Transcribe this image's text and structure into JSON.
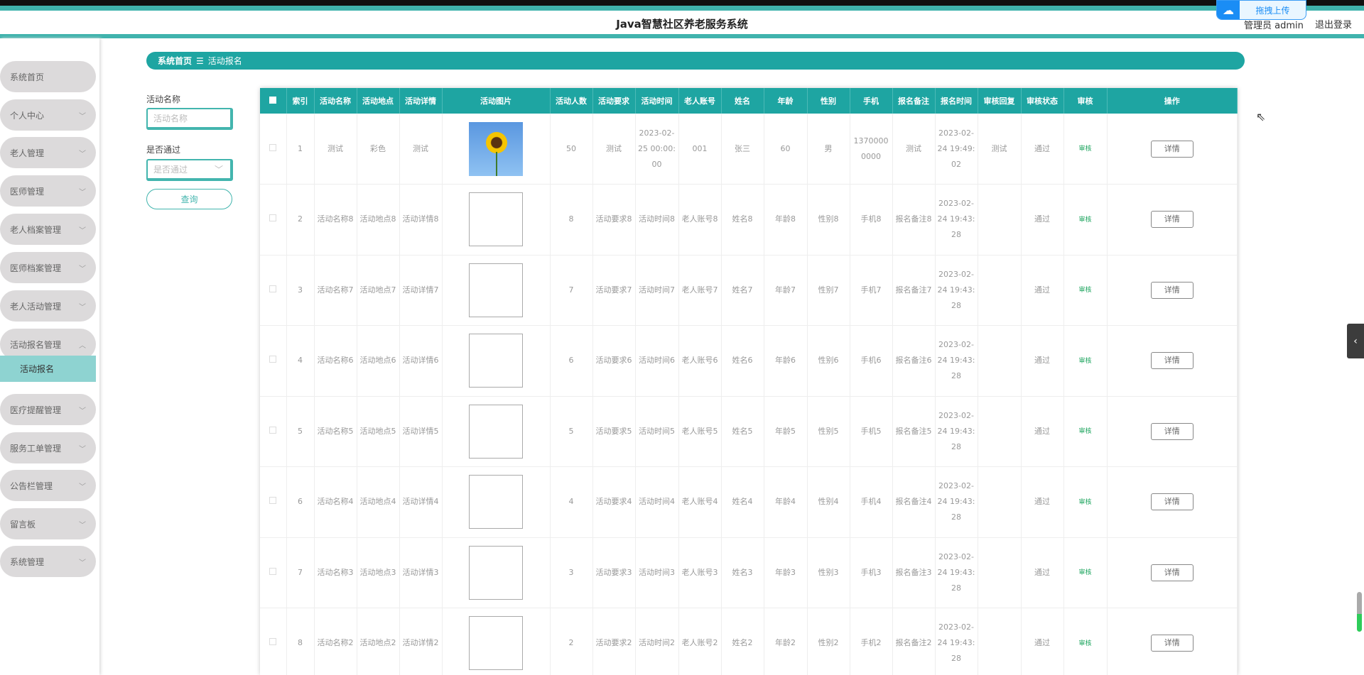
{
  "header": {
    "title": "Java智慧社区养老服务系统",
    "user": "管理员 admin",
    "logout": "退出登录",
    "upload": "拖拽上传"
  },
  "sidebar": {
    "items": [
      {
        "label": "系统首页",
        "chev": ""
      },
      {
        "label": "个人中心",
        "chev": "﹀"
      },
      {
        "label": "老人管理",
        "chev": "﹀"
      },
      {
        "label": "医师管理",
        "chev": "﹀"
      },
      {
        "label": "老人档案管理",
        "chev": "﹀"
      },
      {
        "label": "医师档案管理",
        "chev": "﹀"
      },
      {
        "label": "老人活动管理",
        "chev": "﹀"
      },
      {
        "label": "活动报名管理",
        "chev": "︿"
      },
      {
        "label": "医疗提醒管理",
        "chev": "﹀"
      },
      {
        "label": "服务工单管理",
        "chev": "﹀"
      },
      {
        "label": "公告栏管理",
        "chev": "﹀"
      },
      {
        "label": "留言板",
        "chev": "﹀"
      },
      {
        "label": "系统管理",
        "chev": "﹀"
      }
    ],
    "sub_active": "活动报名"
  },
  "breadcrumb": {
    "home": "系统首页",
    "sep": "☰",
    "current": "活动报名"
  },
  "search": {
    "name_label": "活动名称",
    "name_placeholder": "活动名称",
    "pass_label": "是否通过",
    "pass_placeholder": "是否通过",
    "query": "查询"
  },
  "table": {
    "headers": [
      "索引",
      "活动名称",
      "活动地点",
      "活动详情",
      "活动图片",
      "活动人数",
      "活动要求",
      "活动时间",
      "老人账号",
      "姓名",
      "年龄",
      "性别",
      "手机",
      "报名备注",
      "报名时间",
      "审核回复",
      "审核状态",
      "审核",
      "操作"
    ],
    "audit_label": "审核",
    "detail_label": "详情",
    "rows": [
      [
        "1",
        "测试",
        "彩色",
        "测试",
        "sunflower",
        "50",
        "测试",
        "2023-02-25 00:00:00",
        "001",
        "张三",
        "60",
        "男",
        "13700000000",
        "测试",
        "2023-02-24 19:49:02",
        "测试",
        "通过"
      ],
      [
        "2",
        "活动名称8",
        "活动地点8",
        "活动详情8",
        "",
        "8",
        "活动要求8",
        "活动时间8",
        "老人账号8",
        "姓名8",
        "年龄8",
        "性别8",
        "手机8",
        "报名备注8",
        "2023-02-24 19:43:28",
        "",
        "通过"
      ],
      [
        "3",
        "活动名称7",
        "活动地点7",
        "活动详情7",
        "",
        "7",
        "活动要求7",
        "活动时间7",
        "老人账号7",
        "姓名7",
        "年龄7",
        "性别7",
        "手机7",
        "报名备注7",
        "2023-02-24 19:43:28",
        "",
        "通过"
      ],
      [
        "4",
        "活动名称6",
        "活动地点6",
        "活动详情6",
        "",
        "6",
        "活动要求6",
        "活动时间6",
        "老人账号6",
        "姓名6",
        "年龄6",
        "性别6",
        "手机6",
        "报名备注6",
        "2023-02-24 19:43:28",
        "",
        "通过"
      ],
      [
        "5",
        "活动名称5",
        "活动地点5",
        "活动详情5",
        "",
        "5",
        "活动要求5",
        "活动时间5",
        "老人账号5",
        "姓名5",
        "年龄5",
        "性别5",
        "手机5",
        "报名备注5",
        "2023-02-24 19:43:28",
        "",
        "通过"
      ],
      [
        "6",
        "活动名称4",
        "活动地点4",
        "活动详情4",
        "",
        "4",
        "活动要求4",
        "活动时间4",
        "老人账号4",
        "姓名4",
        "年龄4",
        "性别4",
        "手机4",
        "报名备注4",
        "2023-02-24 19:43:28",
        "",
        "通过"
      ],
      [
        "7",
        "活动名称3",
        "活动地点3",
        "活动详情3",
        "",
        "3",
        "活动要求3",
        "活动时间3",
        "老人账号3",
        "姓名3",
        "年龄3",
        "性别3",
        "手机3",
        "报名备注3",
        "2023-02-24 19:43:28",
        "",
        "通过"
      ],
      [
        "8",
        "活动名称2",
        "活动地点2",
        "活动详情2",
        "",
        "2",
        "活动要求2",
        "活动时间2",
        "老人账号2",
        "姓名2",
        "年龄2",
        "性别2",
        "手机2",
        "报名备注2",
        "2023-02-24 19:43:28",
        "",
        "通过"
      ]
    ]
  }
}
